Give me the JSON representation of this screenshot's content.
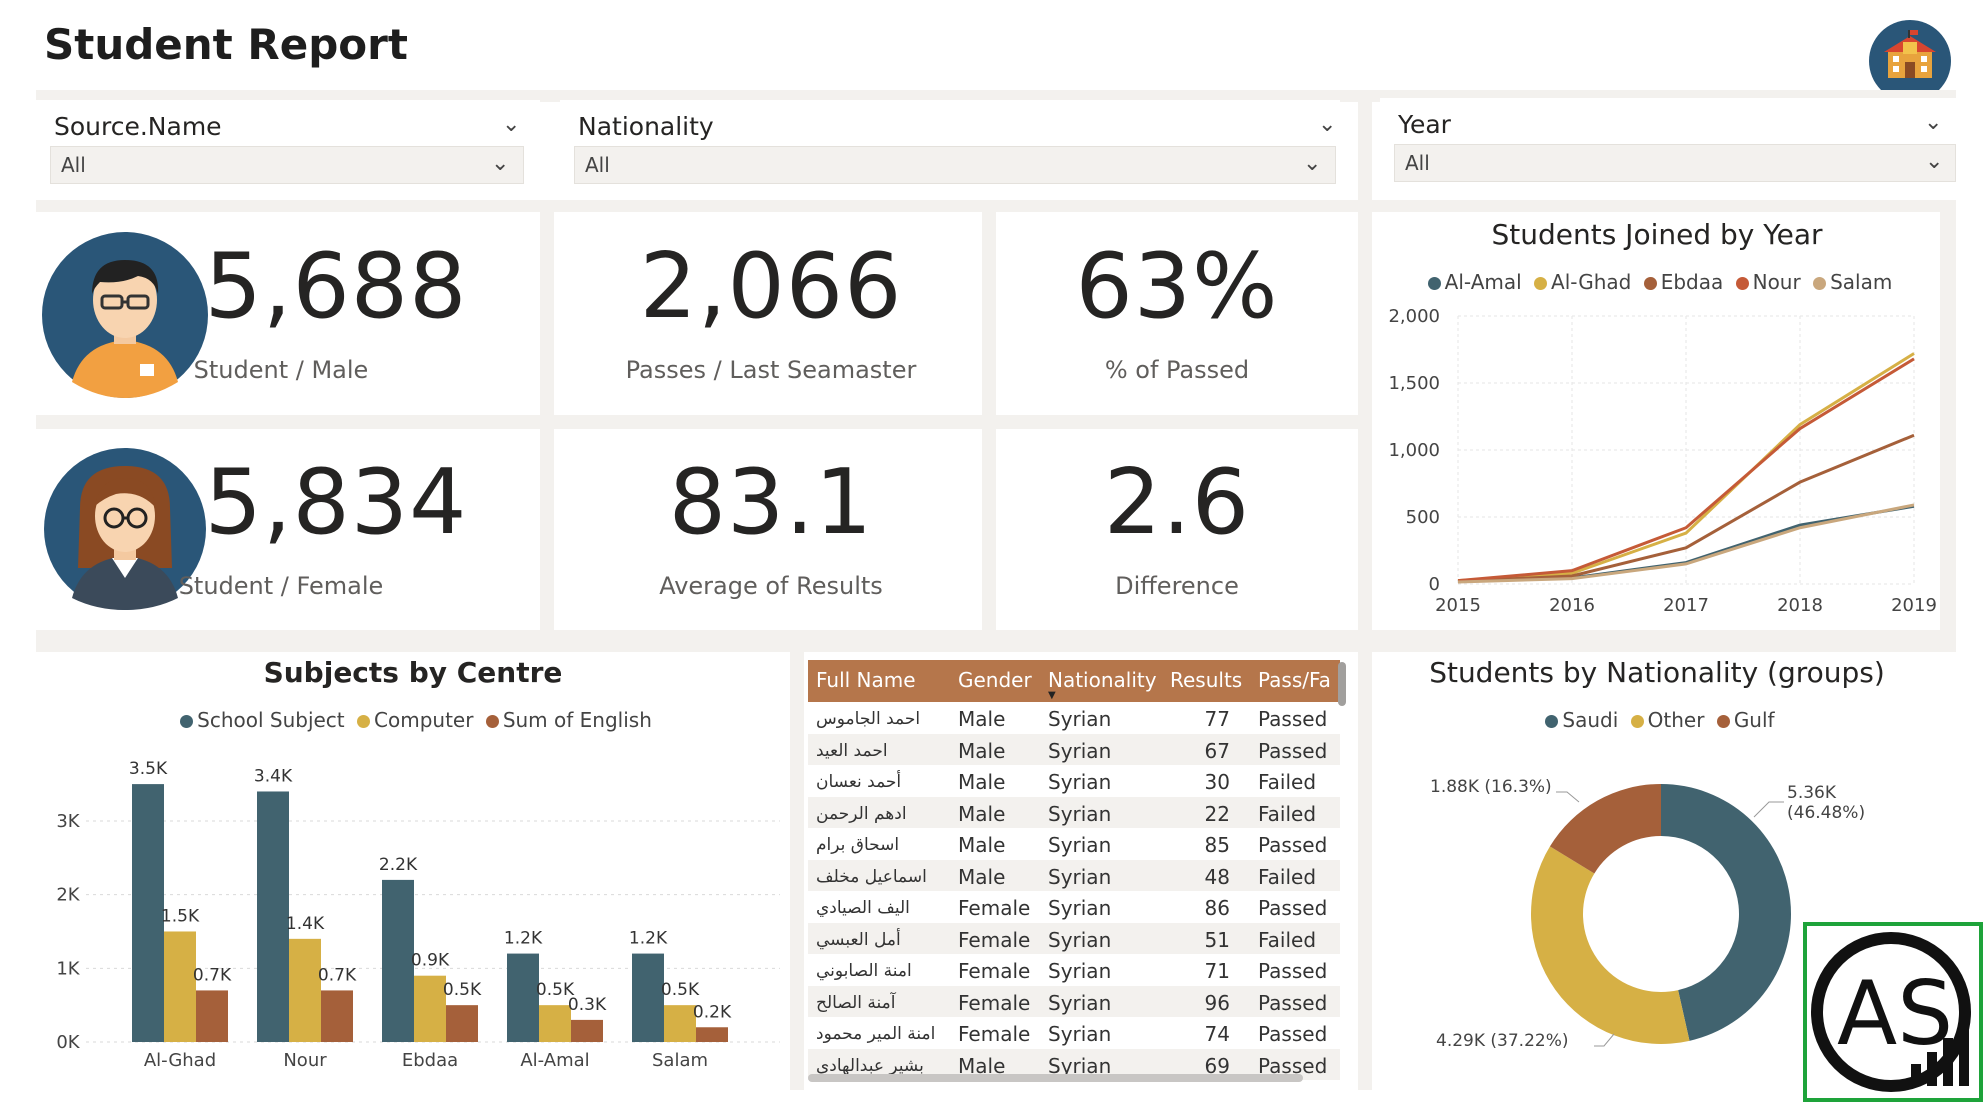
{
  "header": {
    "title": "Student Report"
  },
  "slicers": [
    {
      "label": "Source.Name",
      "value": "All"
    },
    {
      "label": "Nationality",
      "value": "All"
    },
    {
      "label": "Year",
      "value": "All"
    }
  ],
  "kpis": {
    "male": {
      "value": "5,688",
      "label": "Student / Male"
    },
    "female": {
      "value": "5,834",
      "label": "Student / Female"
    },
    "passes": {
      "value": "2,066",
      "label": "Passes / Last Seamaster"
    },
    "pct_passed": {
      "value": "63%",
      "label": "% of Passed"
    },
    "avg_results": {
      "value": "83.1",
      "label": "Average of Results"
    },
    "difference": {
      "value": "2.6",
      "label": "Difference"
    }
  },
  "colors": {
    "slate": "#41636f",
    "gold": "#d6b045",
    "brown": "#a5603a",
    "orange_red": "#c55a37",
    "tan": "#c9a77d",
    "table_header": "#b5764b",
    "navy": "#2a5678"
  },
  "chart_data": [
    {
      "id": "students_joined",
      "type": "line",
      "title": "Students Joined by Year",
      "x": [
        "2015",
        "2016",
        "2017",
        "2018",
        "2019"
      ],
      "ylim": [
        0,
        2000
      ],
      "yticks": [
        "0",
        "500",
        "1,000",
        "1,500",
        "2,000"
      ],
      "grid": true,
      "legend_position": "top",
      "series": [
        {
          "name": "Al-Amal",
          "color": "#41636f",
          "values": [
            20,
            45,
            160,
            440,
            580
          ]
        },
        {
          "name": "Al-Ghad",
          "color": "#d6b045",
          "values": [
            25,
            80,
            380,
            1190,
            1720
          ]
        },
        {
          "name": "Ebdaa",
          "color": "#a5603a",
          "values": [
            20,
            60,
            270,
            760,
            1110
          ]
        },
        {
          "name": "Nour",
          "color": "#c55a37",
          "values": [
            25,
            100,
            420,
            1160,
            1680
          ]
        },
        {
          "name": "Salam",
          "color": "#c9a77d",
          "values": [
            15,
            40,
            150,
            420,
            590
          ]
        }
      ]
    },
    {
      "id": "subjects_by_centre",
      "type": "bar",
      "title": "Subjects by Centre",
      "categories": [
        "Al-Ghad",
        "Nour",
        "Ebdaa",
        "Al-Amal",
        "Salam"
      ],
      "ylim": [
        0,
        3500
      ],
      "yticks": [
        "0K",
        "1K",
        "2K",
        "3K"
      ],
      "grid": true,
      "legend_position": "top",
      "series": [
        {
          "name": "School Subject",
          "color": "#41636f",
          "values": [
            3500,
            3400,
            2200,
            1200,
            1200
          ],
          "labels": [
            "3.5K",
            "3.4K",
            "2.2K",
            "1.2K",
            "1.2K"
          ]
        },
        {
          "name": "Computer",
          "color": "#d6b045",
          "values": [
            1500,
            1400,
            900,
            500,
            500
          ],
          "labels": [
            "1.5K",
            "1.4K",
            "0.9K",
            "0.5K",
            "0.5K"
          ]
        },
        {
          "name": "Sum of English",
          "color": "#a5603a",
          "values": [
            700,
            700,
            500,
            300,
            200
          ],
          "labels": [
            "0.7K",
            "0.7K",
            "0.5K",
            "0.3K",
            "0.2K"
          ]
        }
      ]
    },
    {
      "id": "students_by_nationality",
      "type": "pie",
      "title": "Students by Nationality (groups)",
      "legend_position": "top",
      "slices": [
        {
          "name": "Saudi",
          "value": 46.48,
          "color": "#41636f",
          "label_line1": "5.36K",
          "label_line2": "(46.48%)"
        },
        {
          "name": "Other",
          "value": 37.22,
          "color": "#d6b045",
          "label_line1": "4.29K (37.22%)",
          "label_line2": ""
        },
        {
          "name": "Gulf",
          "value": 16.3,
          "color": "#a5603a",
          "label_line1": "1.88K (16.3%)",
          "label_line2": ""
        }
      ]
    }
  ],
  "table": {
    "columns": [
      "Full Name",
      "Gender",
      "Nationality",
      "Results",
      "Pass/Fa"
    ],
    "rows": [
      [
        "احمد الجاموس",
        "Male",
        "Syrian",
        "77",
        "Passed"
      ],
      [
        "احمد العيد",
        "Male",
        "Syrian",
        "67",
        "Passed"
      ],
      [
        "أحمد نعسان",
        "Male",
        "Syrian",
        "30",
        "Failed"
      ],
      [
        "ادهم الرحمن",
        "Male",
        "Syrian",
        "22",
        "Failed"
      ],
      [
        "اسحاق برام",
        "Male",
        "Syrian",
        "85",
        "Passed"
      ],
      [
        "اسماعيل مخلف",
        "Male",
        "Syrian",
        "48",
        "Failed"
      ],
      [
        "اليف الصيادي",
        "Female",
        "Syrian",
        "86",
        "Passed"
      ],
      [
        "أمل العبسي",
        "Female",
        "Syrian",
        "51",
        "Failed"
      ],
      [
        "امنة الصابوني",
        "Female",
        "Syrian",
        "71",
        "Passed"
      ],
      [
        "آمنة الصالح",
        "Female",
        "Syrian",
        "96",
        "Passed"
      ],
      [
        "امنة المير محمود",
        "Female",
        "Syrian",
        "74",
        "Passed"
      ],
      [
        "بشير عبدالهادى",
        "Male",
        "Syrian",
        "69",
        "Passed"
      ]
    ]
  },
  "watermark": {
    "text": "AS"
  }
}
